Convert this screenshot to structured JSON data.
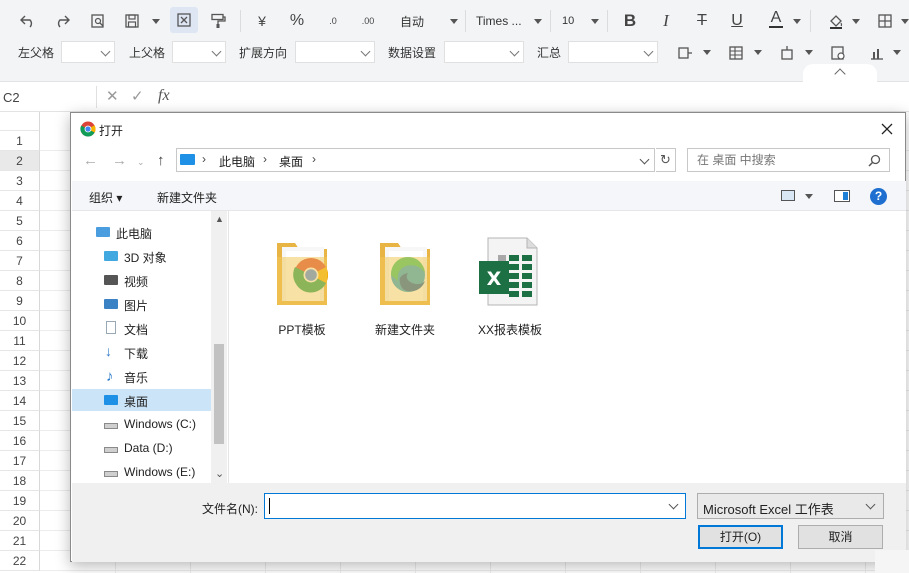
{
  "ribbon": {
    "font_size_mode": "自动",
    "font_name": "Times ...",
    "font_size": "10",
    "currency_symbol": "¥",
    "percent_symbol": "%",
    "inc_decimal": ".0",
    "dec_decimal": ".00",
    "pivot_labels": [
      "左父格",
      "上父格",
      "扩展方向",
      "数据设置",
      "汇总"
    ]
  },
  "formula_bar": {
    "cell_ref": "C2",
    "fx_label": "fx"
  },
  "sheet": {
    "rows": [
      "1",
      "2",
      "3",
      "4",
      "5",
      "6",
      "7",
      "8",
      "9",
      "10",
      "11",
      "12",
      "13",
      "14",
      "15",
      "16",
      "17",
      "18",
      "19",
      "20",
      "21",
      "22"
    ],
    "active_row": "2"
  },
  "dialog": {
    "title": "打开",
    "address": [
      "此电脑",
      "桌面"
    ],
    "search_placeholder": "在 桌面 中搜索",
    "organize": "组织",
    "new_folder": "新建文件夹",
    "nav_items": [
      {
        "label": "此电脑",
        "icon": "computer-icon"
      },
      {
        "label": "3D 对象",
        "icon": "cube-icon"
      },
      {
        "label": "视频",
        "icon": "video-icon"
      },
      {
        "label": "图片",
        "icon": "picture-icon"
      },
      {
        "label": "文档",
        "icon": "document-icon"
      },
      {
        "label": "下载",
        "icon": "download-icon"
      },
      {
        "label": "音乐",
        "icon": "music-icon"
      },
      {
        "label": "桌面",
        "icon": "desktop-icon"
      },
      {
        "label": "Windows (C:)",
        "icon": "drive-icon"
      },
      {
        "label": "Data (D:)",
        "icon": "drive-icon"
      },
      {
        "label": "Windows (E:)",
        "icon": "drive-icon"
      }
    ],
    "active_nav": "桌面",
    "files": [
      {
        "label": "PPT模板",
        "icon": "folder-chrome-icon"
      },
      {
        "label": "新建文件夹",
        "icon": "folder-edge-icon"
      },
      {
        "label": "XX报表模板",
        "icon": "excel-file-icon"
      }
    ],
    "filename_label": "文件名(N):",
    "filename_value": "",
    "filetype": "Microsoft Excel 工作表",
    "open_button": "打开(O)",
    "cancel_button": "取消"
  },
  "colors": {
    "accent": "#0078d7",
    "excel_green": "#1d7044",
    "folder_yellow": "#f3c95a",
    "ribbon_bg": "#f3f4f6"
  }
}
